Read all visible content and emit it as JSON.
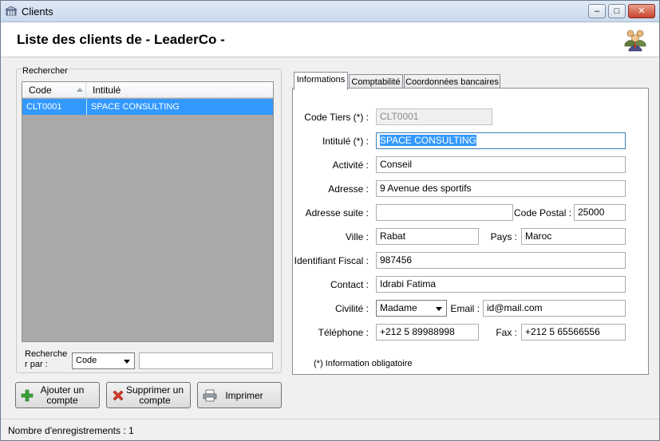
{
  "window": {
    "title": "Clients",
    "minimize": "–",
    "maximize": "□",
    "close": "✕"
  },
  "header": {
    "title": "Liste des clients de - LeaderCo -",
    "icon": "users-group-icon"
  },
  "search_group": {
    "label": "Rechercher",
    "columns": [
      "Code",
      "Intitulé"
    ],
    "rows": [
      {
        "code": "CLT0001",
        "intitule": "SPACE CONSULTING",
        "selected": true
      }
    ],
    "search_by_label": "Recherche r par :",
    "search_by_value": "Code",
    "search_text": ""
  },
  "buttons": {
    "add": "Ajouter un compte",
    "delete": "Supprimer un compte",
    "print": "Imprimer"
  },
  "tabs": [
    {
      "label": "Informations",
      "active": true
    },
    {
      "label": "Comptabilité",
      "active": false
    },
    {
      "label": "Coordonnées bancaires",
      "active": false
    }
  ],
  "form": {
    "code_tiers": {
      "label": "Code Tiers (*) :",
      "value": "CLT0001"
    },
    "intitule": {
      "label": "Intitulé (*) :",
      "value": "SPACE CONSULTING"
    },
    "activite": {
      "label": "Activité :",
      "value": "Conseil"
    },
    "adresse": {
      "label": "Adresse :",
      "value": "9 Avenue des sportifs"
    },
    "adresse_suite": {
      "label": "Adresse suite :",
      "value": ""
    },
    "code_postal": {
      "label": "Code Postal :",
      "value": "25000"
    },
    "ville": {
      "label": "Ville :",
      "value": "Rabat"
    },
    "pays": {
      "label": "Pays :",
      "value": "Maroc"
    },
    "identifiant_fiscal": {
      "label": "Identifiant Fiscal :",
      "value": "987456"
    },
    "contact": {
      "label": "Contact :",
      "value": "Idrabi Fatima"
    },
    "civilite": {
      "label": "Civilité :",
      "value": "Madame"
    },
    "email": {
      "label": "Email :",
      "value": "id@mail.com"
    },
    "telephone": {
      "label": "Téléphone :",
      "value": "+212 5 89988998"
    },
    "fax": {
      "label": "Fax :",
      "value": "+212 5 65566556"
    },
    "note": "(*) Information obligatoire"
  },
  "status": {
    "text": "Nombre d'enregistrements :  1"
  },
  "colors": {
    "selection": "#3399ff",
    "grid_background": "#a9a9a9"
  }
}
